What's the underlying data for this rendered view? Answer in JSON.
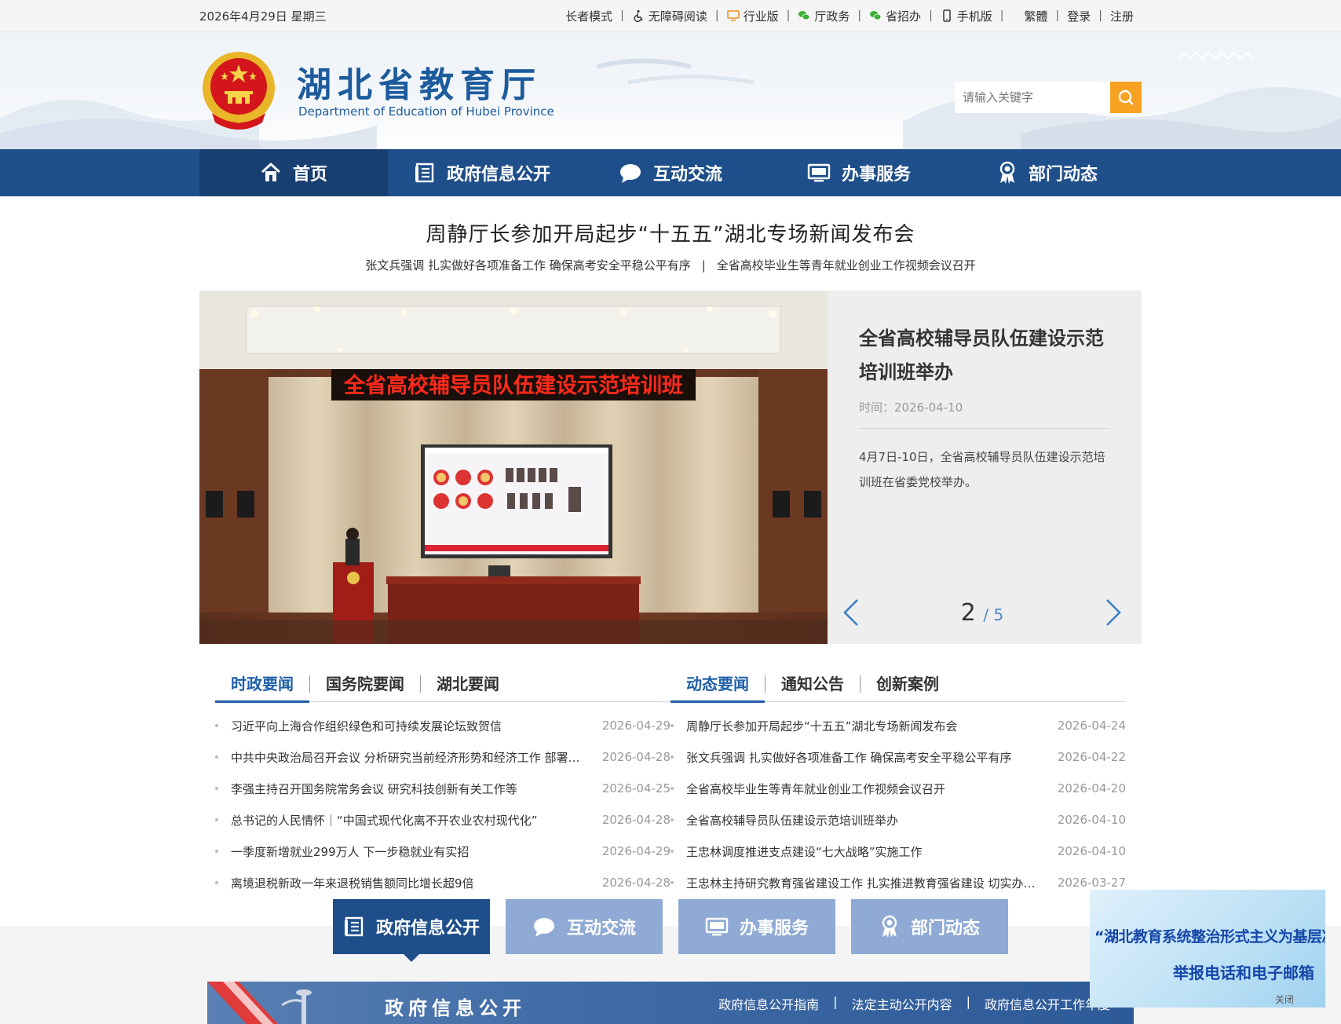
{
  "topbar": {
    "date": "2026年4月29日 星期三",
    "links": [
      "长者模式",
      "无障碍阅读",
      "行业版",
      "厅政务",
      "省招办",
      "手机版"
    ],
    "lang": "繁體",
    "login": "登录",
    "register": "注册"
  },
  "header": {
    "title": "湖北省教育厅",
    "subtitle": "Department of Education of Hubei Province",
    "search_placeholder": "请输入关键字"
  },
  "nav": {
    "items": [
      "首页",
      "政府信息公开",
      "互动交流",
      "办事服务",
      "部门动态"
    ]
  },
  "headline": {
    "title": "周静厅长参加开局起步“十五五”湖北专场新闻发布会",
    "sub1": "张文兵强调 扎实做好各项准备工作 确保高考安全平稳公平有序",
    "sep": "|",
    "sub2": "全省高校毕业生等青年就业创业工作视频会议召开"
  },
  "carousel": {
    "banner_text": "全省高校辅导员队伍建设示范培训班",
    "title": "全省高校辅导员队伍建设示范培训班举办",
    "time": "时间：2026-04-10",
    "desc": "4月7日-10日，全省高校辅导员队伍建设示范培训班在省委党校举办。",
    "current": "2",
    "total": "/ 5"
  },
  "news_left": {
    "tabs": [
      "时政要闻",
      "国务院要闻",
      "湖北要闻"
    ],
    "items": [
      {
        "title": "习近平向上海合作组织绿色和可持续发展论坛致贺信",
        "date": "2026-04-29"
      },
      {
        "title": "中共中央政治局召开会议 分析研究当前经济形势和经济工作 部署下半年经济工作",
        "date": "2026-04-28"
      },
      {
        "title": "李强主持召开国务院常务会议 研究科技创新有关工作等",
        "date": "2026-04-25"
      },
      {
        "title": "总书记的人民情怀｜“中国式现代化离不开农业农村现代化”",
        "date": "2026-04-28"
      },
      {
        "title": "一季度新增就业299万人 下一步稳就业有实招",
        "date": "2026-04-29"
      },
      {
        "title": "离境退税新政一年来退税销售额同比增长超9倍",
        "date": "2026-04-28"
      }
    ]
  },
  "news_right": {
    "tabs": [
      "动态要闻",
      "通知公告",
      "创新案例"
    ],
    "items": [
      {
        "title": "周静厅长参加开局起步“十五五”湖北专场新闻发布会",
        "date": "2026-04-24"
      },
      {
        "title": "张文兵强调 扎实做好各项准备工作 确保高考安全平稳公平有序",
        "date": "2026-04-22"
      },
      {
        "title": "全省高校毕业生等青年就业创业工作视频会议召开",
        "date": "2026-04-20"
      },
      {
        "title": "全省高校辅导员队伍建设示范培训班举办",
        "date": "2026-04-10"
      },
      {
        "title": "王忠林调度推进支点建设“七大战略”实施工作",
        "date": "2026-04-10"
      },
      {
        "title": "王忠林主持研究教育强省建设工作 扎实推进教育强省建设 切实办好人民满意的教育",
        "date": "2026-03-27"
      }
    ]
  },
  "section_buttons": [
    "政府信息公开",
    "互动交流",
    "办事服务",
    "部门动态"
  ],
  "banner": {
    "title": "政府信息公开",
    "links": [
      "政府信息公开指南",
      "法定主动公开内容",
      "政府信息公开工作年度"
    ],
    "sep": "|"
  },
  "float_ad": {
    "line1": "“湖北教育系统整治形式主义为基层减负”",
    "line2": "举报电话和电子邮箱",
    "close": "关闭"
  },
  "colors": {
    "nav_bg": "#1f4f8a",
    "accent_blue": "#1f5fa8",
    "search_btn": "#f7a221",
    "button_inactive": "#8faad4"
  }
}
